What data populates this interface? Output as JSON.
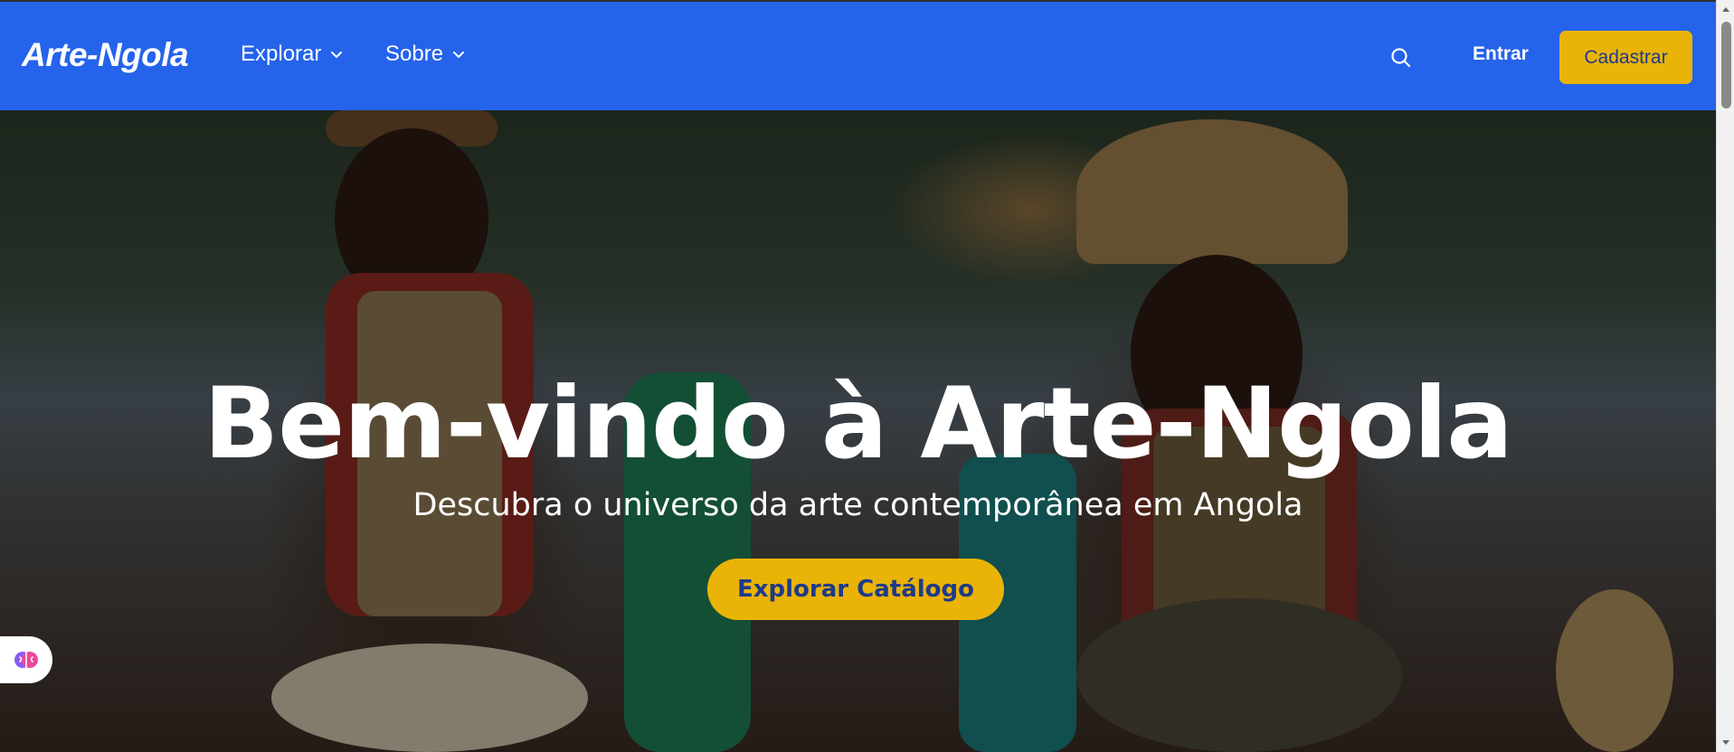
{
  "navbar": {
    "brand": "Arte-Ngola",
    "menu": [
      {
        "label": "Explorar"
      },
      {
        "label": "Sobre"
      }
    ],
    "login_label": "Entrar",
    "signup_label": "Cadastrar"
  },
  "hero": {
    "title": "Bem-vindo à Arte-Ngola",
    "subtitle": "Descubra o universo da arte contemporânea em Angola",
    "cta_label": "Explorar Catálogo"
  },
  "colors": {
    "nav_bg": "#2563eb",
    "accent": "#eab308",
    "accent_text": "#1e3a8a"
  },
  "icons": [
    "chevron-down-icon",
    "search-icon",
    "brain-icon"
  ]
}
